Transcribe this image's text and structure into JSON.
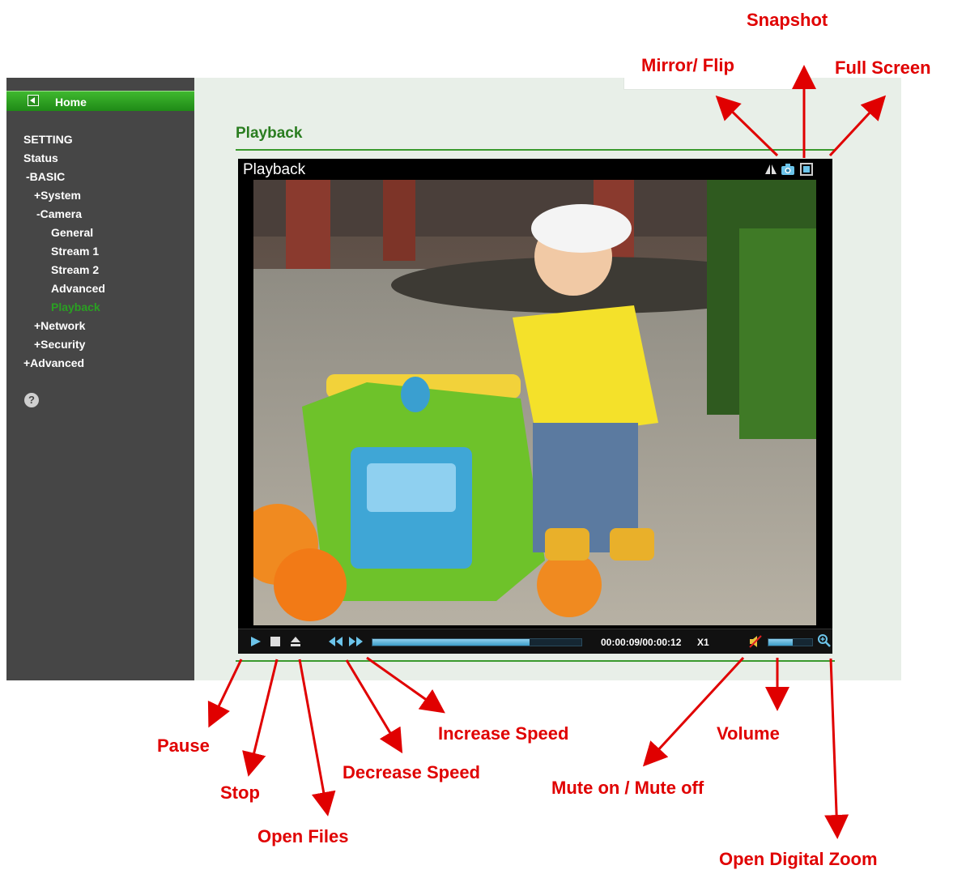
{
  "sidebar": {
    "home": "Home",
    "setting": "SETTING",
    "status": "Status",
    "basic": "-BASIC",
    "system": "+System",
    "camera": "-Camera",
    "general": "General",
    "stream1": "Stream 1",
    "stream2": "Stream 2",
    "advanced_sub": "Advanced",
    "playback": "Playback",
    "network": "+Network",
    "security": "+Security",
    "advanced": "+Advanced",
    "help_glyph": "?"
  },
  "main": {
    "title": "Playback",
    "player_title": "Playback"
  },
  "player": {
    "time": "00:00:09/00:00:12",
    "speed": "X1",
    "progress": 0.75,
    "volume": 0.55
  },
  "annotations": {
    "snapshot": "Snapshot",
    "mirror_flip": "Mirror/ Flip",
    "full_screen": "Full Screen",
    "pause": "Pause",
    "stop": "Stop",
    "open_files": "Open Files",
    "decrease_speed": "Decrease Speed",
    "increase_speed": "Increase Speed",
    "volume": "Volume",
    "mute": "Mute on / Mute off",
    "open_digital_zoom": "Open Digital Zoom"
  },
  "colors": {
    "accent_green": "#2aa022",
    "annotation_red": "#e00000",
    "sidebar_bg": "#464646",
    "progress_blue": "#5bb8e0"
  },
  "icons": [
    "home-arrow-icon",
    "help-icon",
    "mirror-flip-icon",
    "snapshot-camera-icon",
    "full-screen-icon",
    "play-icon",
    "stop-icon",
    "eject-icon",
    "rewind-icon",
    "fast-forward-icon",
    "mute-icon",
    "zoom-icon"
  ]
}
